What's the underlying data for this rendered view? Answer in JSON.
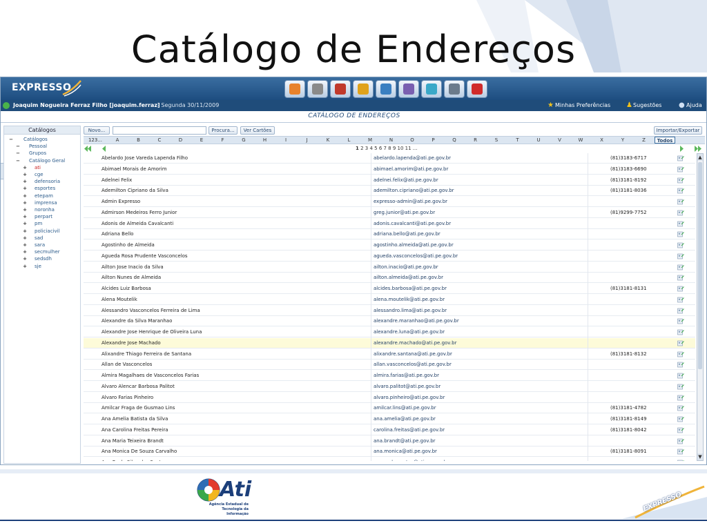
{
  "slide": {
    "title": "Catálogo de Endereços",
    "footer_logo_text": "Ati",
    "footer_logo_sub1": "Agência Estadual de",
    "footer_logo_sub2": "Tecnologia da Informação",
    "footer_expresso": "EXPRESSO"
  },
  "app": {
    "brand": "EXPRESSO",
    "toolbar": [
      "home-icon",
      "settings-icon",
      "people-icon",
      "address-book-icon",
      "mail-icon",
      "calendar-icon",
      "chat-icon",
      "calculator-icon",
      "logout-icon"
    ],
    "user_label": "Joaquim Nogueira Ferraz Filho [joaquim.ferraz]",
    "date_label": "- Segunda 30/11/2009",
    "prefs_label": "Minhas Preferências",
    "suggest_label": "Sugestões",
    "help_label": "Ajuda",
    "module_title": "CATÁLOGO DE ENDEREÇOS"
  },
  "sidebar": {
    "header": "Catálogos",
    "nodes": [
      {
        "sign": "−",
        "label": "Catálogos",
        "level": 0
      },
      {
        "sign": "−",
        "label": "Pessoal",
        "level": 1
      },
      {
        "sign": "−",
        "label": "Grupos",
        "level": 1
      },
      {
        "sign": "−",
        "label": "Catálogo Geral",
        "level": 1
      },
      {
        "sign": "+",
        "label": "ati",
        "level": 2,
        "active": true
      },
      {
        "sign": "+",
        "label": "cge",
        "level": 2
      },
      {
        "sign": "+",
        "label": "defensoria",
        "level": 2
      },
      {
        "sign": "+",
        "label": "esportes",
        "level": 2
      },
      {
        "sign": "+",
        "label": "etepam",
        "level": 2
      },
      {
        "sign": "+",
        "label": "imprensa",
        "level": 2
      },
      {
        "sign": "+",
        "label": "noronha",
        "level": 2
      },
      {
        "sign": "+",
        "label": "perpart",
        "level": 2
      },
      {
        "sign": "+",
        "label": "pm",
        "level": 2
      },
      {
        "sign": "+",
        "label": "policiacivil",
        "level": 2
      },
      {
        "sign": "+",
        "label": "sad",
        "level": 2
      },
      {
        "sign": "+",
        "label": "sara",
        "level": 2
      },
      {
        "sign": "+",
        "label": "secmulher",
        "level": 2
      },
      {
        "sign": "+",
        "label": "sedsdh",
        "level": 2
      },
      {
        "sign": "+",
        "label": "sje",
        "level": 2
      }
    ]
  },
  "search": {
    "new_label": "Novo...",
    "search_label": "Procura...",
    "cards_label": "Ver Cartões",
    "import_label": "Importar/Exportar",
    "value": ""
  },
  "alphabet": [
    "123...",
    "A",
    "B",
    "C",
    "D",
    "E",
    "F",
    "G",
    "H",
    "I",
    "J",
    "K",
    "L",
    "M",
    "N",
    "O",
    "P",
    "Q",
    "R",
    "S",
    "T",
    "U",
    "V",
    "W",
    "X",
    "Y",
    "Z",
    "Todos"
  ],
  "alphabet_active": "Todos",
  "pager": {
    "current": "1",
    "rest": "2 3 4 5 6 7 8 9 10 11 ..."
  },
  "contacts": [
    {
      "name": "Abelardo Jose Vareda Lapenda Filho",
      "email": "abelardo.lapenda@ati.pe.gov.br",
      "phone": "(81)3183-6717"
    },
    {
      "name": "Abimael Morais de Amorim",
      "email": "abimael.amorim@ati.pe.gov.br",
      "phone": "(81)3183-6690"
    },
    {
      "name": "Adelnei Felix",
      "email": "adelnei.felix@ati.pe.gov.br",
      "phone": "(81)3181-8192"
    },
    {
      "name": "Ademilton Cipriano da Silva",
      "email": "ademilton.cipriano@ati.pe.gov.br",
      "phone": "(81)3181-8036"
    },
    {
      "name": "Admin Expresso",
      "email": "expresso-admin@ati.pe.gov.br",
      "phone": ""
    },
    {
      "name": "Admirson Medeiros Ferro Junior",
      "email": "greg.junior@ati.pe.gov.br",
      "phone": "(81)9299-7752"
    },
    {
      "name": "Adonis de Almeida Cavalcanti",
      "email": "adonis.cavalcanti@ati.pe.gov.br",
      "phone": ""
    },
    {
      "name": "Adriana Bello",
      "email": "adriana.bello@ati.pe.gov.br",
      "phone": ""
    },
    {
      "name": "Agostinho de Almeida",
      "email": "agostinho.almeida@ati.pe.gov.br",
      "phone": ""
    },
    {
      "name": "Agueda Rosa Prudente Vasconcelos",
      "email": "agueda.vasconcelos@ati.pe.gov.br",
      "phone": ""
    },
    {
      "name": "Ailton Jose Inacio da Silva",
      "email": "ailton.inacio@ati.pe.gov.br",
      "phone": ""
    },
    {
      "name": "Ailton Nunes de Almeida",
      "email": "ailton.almeida@ati.pe.gov.br",
      "phone": ""
    },
    {
      "name": "Alcides Luiz Barbosa",
      "email": "alcides.barbosa@ati.pe.gov.br",
      "phone": "(81)3181-8131"
    },
    {
      "name": "Alena Moutelik",
      "email": "alena.moutelik@ati.pe.gov.br",
      "phone": ""
    },
    {
      "name": "Alessandro Vasconcelos Ferreira de Lima",
      "email": "alessandro.lima@ati.pe.gov.br",
      "phone": ""
    },
    {
      "name": "Alexandre da Silva Maranhao",
      "email": "alexandre.maranhao@ati.pe.gov.br",
      "phone": ""
    },
    {
      "name": "Alexandre Jose Henrique de Oliveira Luna",
      "email": "alexandre.luna@ati.pe.gov.br",
      "phone": ""
    },
    {
      "name": "Alexandre Jose Machado",
      "email": "alexandre.machado@ati.pe.gov.br",
      "phone": "",
      "highlight": true
    },
    {
      "name": "Alixandre Thiago Ferreira de Santana",
      "email": "alixandre.santana@ati.pe.gov.br",
      "phone": "(81)3181-8132"
    },
    {
      "name": "Allan de Vasconcelos",
      "email": "allan.vasconcelos@ati.pe.gov.br",
      "phone": ""
    },
    {
      "name": "Almira Magalhaes de Vasconcelos Farias",
      "email": "almira.farias@ati.pe.gov.br",
      "phone": ""
    },
    {
      "name": "Alvaro Alencar Barbosa Palitot",
      "email": "alvaro.palitot@ati.pe.gov.br",
      "phone": ""
    },
    {
      "name": "Alvaro Farias Pinheiro",
      "email": "alvaro.pinheiro@ati.pe.gov.br",
      "phone": ""
    },
    {
      "name": "Amilcar Fraga de Gusmao Lins",
      "email": "amilcar.lins@ati.pe.gov.br",
      "phone": "(81)3181-4782"
    },
    {
      "name": "Ana Amelia Batista da Silva",
      "email": "ana.amelia@ati.pe.gov.br",
      "phone": "(81)3181-8149"
    },
    {
      "name": "Ana Carolina Freitas Pereira",
      "email": "carolina.freitas@ati.pe.gov.br",
      "phone": "(81)3181-8042"
    },
    {
      "name": "Ana Maria Teixeira Brandt",
      "email": "ana.brandt@ati.pe.gov.br",
      "phone": ""
    },
    {
      "name": "Ana Monica De Souza Carvalho",
      "email": "ana.monica@ati.pe.gov.br",
      "phone": "(81)3181-8091"
    },
    {
      "name": "Ana Paula Silva dos Santos",
      "email": "anapaula.santos@ati.pe.gov.br",
      "phone": ""
    }
  ],
  "colors": {
    "header": "#1f4c7a",
    "accent": "#3a6ea0",
    "highlight": "#fdfbd9",
    "link": "#213f66"
  }
}
